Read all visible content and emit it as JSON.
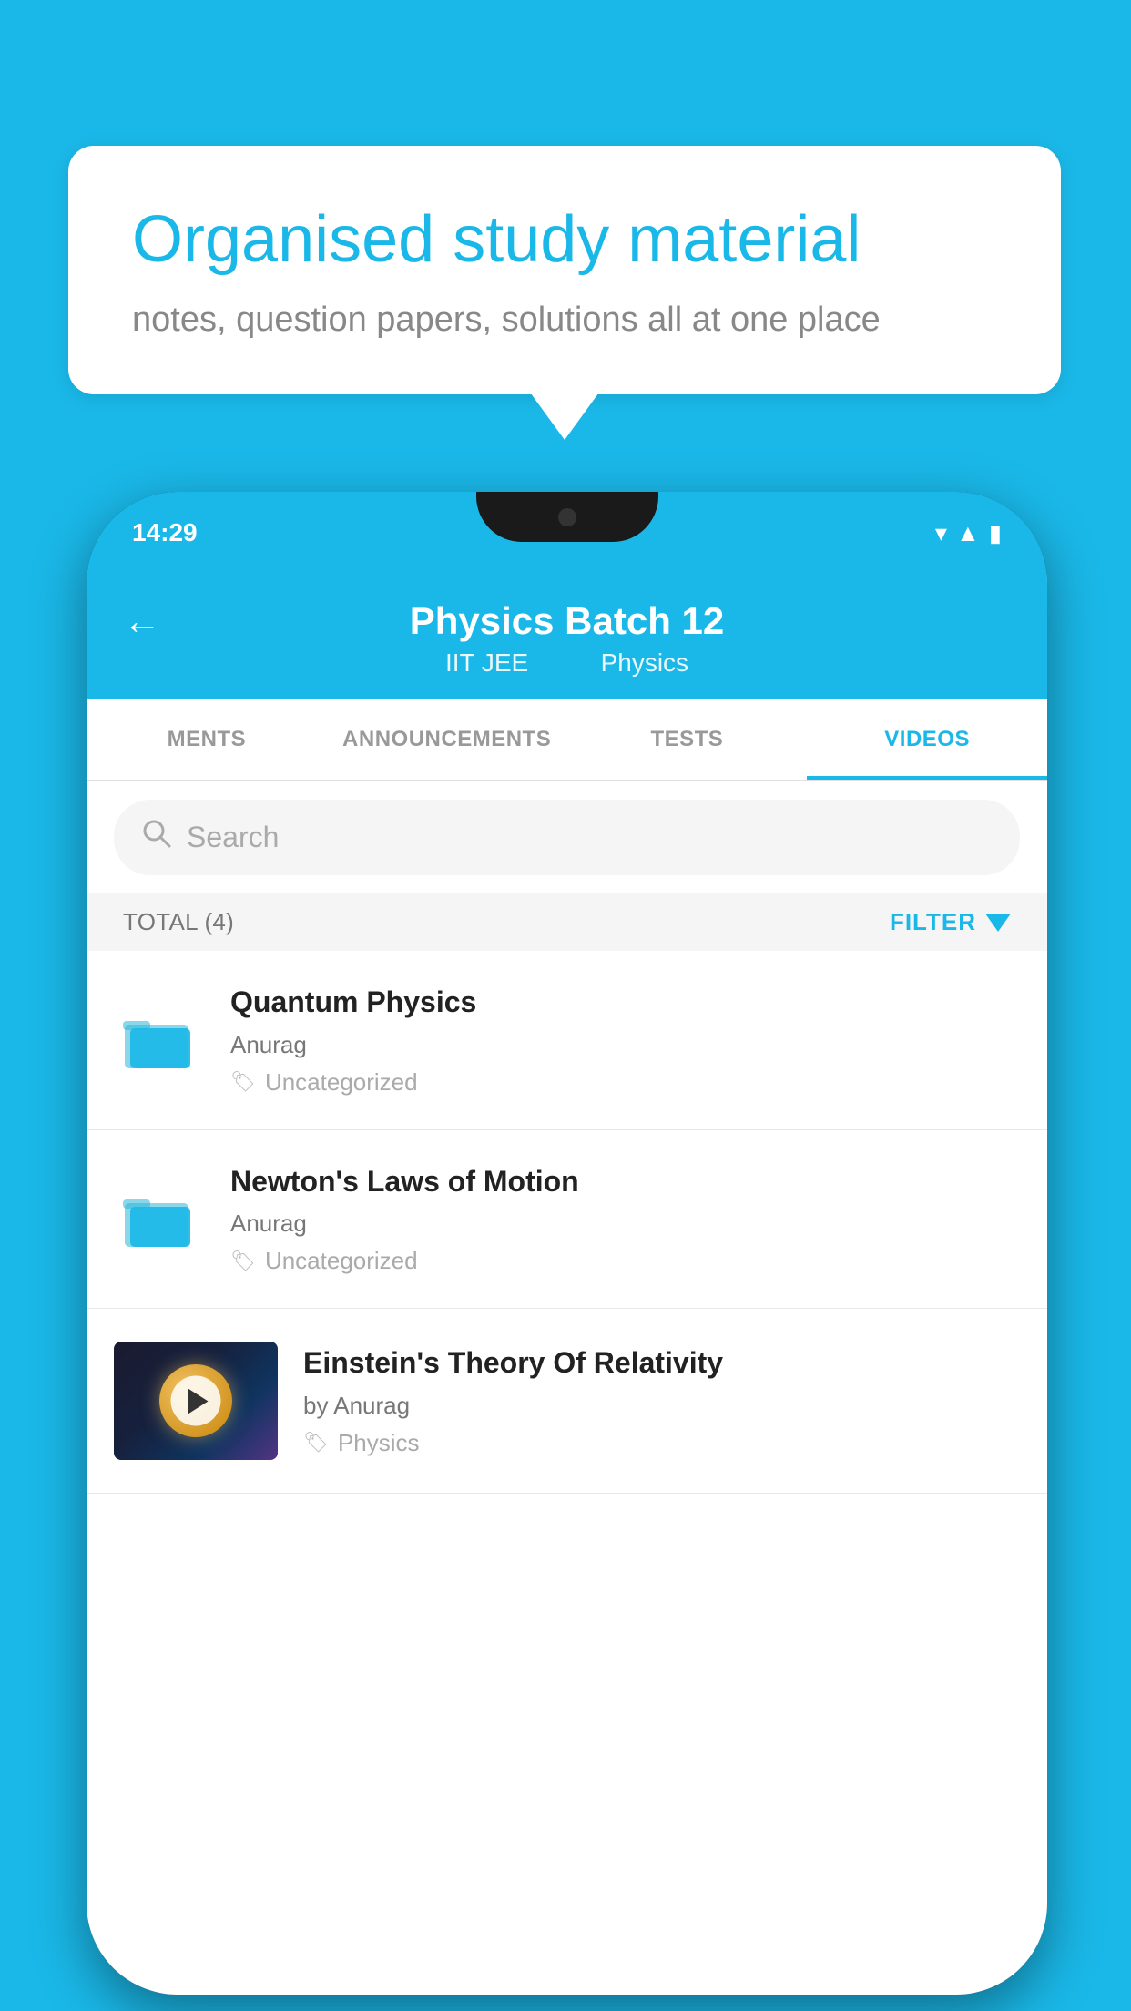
{
  "background": {
    "color": "#1ab8e8"
  },
  "speech_bubble": {
    "title": "Organised study material",
    "subtitle": "notes, question papers, solutions all at one place"
  },
  "phone": {
    "status_bar": {
      "time": "14:29"
    },
    "header": {
      "back_label": "←",
      "title": "Physics Batch 12",
      "subtitle_part1": "IIT JEE",
      "subtitle_part2": "Physics"
    },
    "tabs": [
      {
        "label": "MENTS",
        "active": false
      },
      {
        "label": "ANNOUNCEMENTS",
        "active": false
      },
      {
        "label": "TESTS",
        "active": false
      },
      {
        "label": "VIDEOS",
        "active": true
      }
    ],
    "search": {
      "placeholder": "Search"
    },
    "filter_row": {
      "total_label": "TOTAL (4)",
      "filter_label": "FILTER"
    },
    "videos": [
      {
        "id": 1,
        "title": "Quantum Physics",
        "author": "Anurag",
        "tag": "Uncategorized",
        "type": "folder"
      },
      {
        "id": 2,
        "title": "Newton's Laws of Motion",
        "author": "Anurag",
        "tag": "Uncategorized",
        "type": "folder"
      },
      {
        "id": 3,
        "title": "Einstein's Theory Of Relativity",
        "author": "by Anurag",
        "tag": "Physics",
        "type": "video"
      }
    ]
  }
}
